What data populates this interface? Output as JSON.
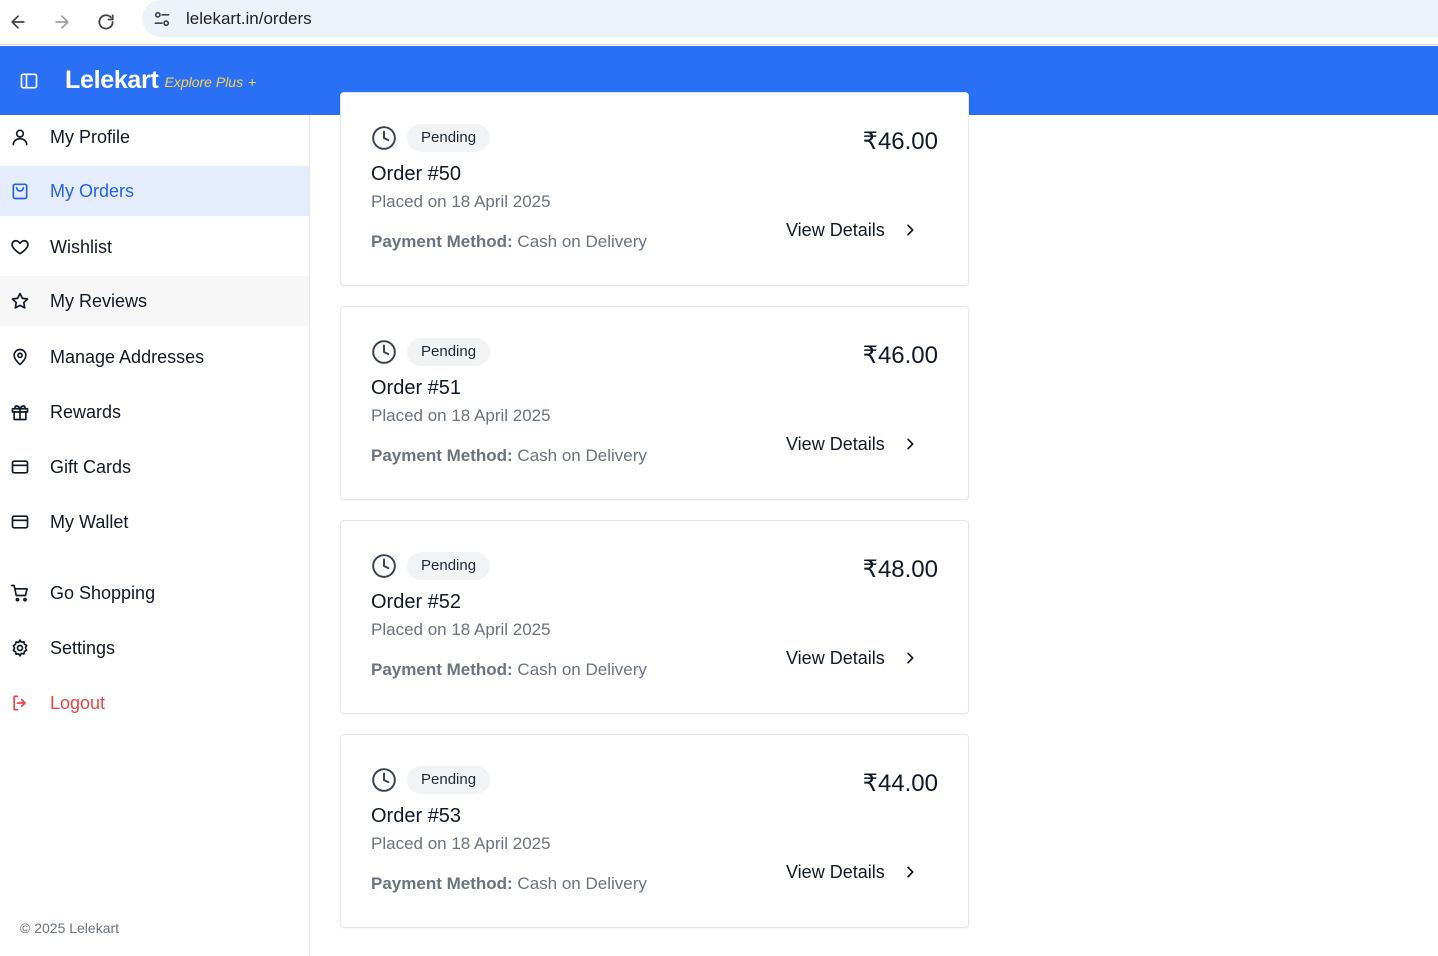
{
  "browser": {
    "url": "lelekart.in/orders"
  },
  "header": {
    "brand": "Lelekart",
    "brand_sub": "Explore Plus",
    "brand_plus": "+",
    "colors": {
      "background": "#2970f4",
      "brand_sub": "#fcd34d"
    }
  },
  "sidebar": {
    "items": [
      {
        "label": "My Profile",
        "icon": "user-icon"
      },
      {
        "label": "My Orders",
        "icon": "shopping-bag-icon",
        "active": true
      },
      {
        "label": "Wishlist",
        "icon": "heart-icon"
      },
      {
        "label": "My Reviews",
        "icon": "star-icon"
      },
      {
        "label": "Manage Addresses",
        "icon": "map-pin-icon"
      },
      {
        "label": "Rewards",
        "icon": "gift-icon"
      },
      {
        "label": "Gift Cards",
        "icon": "credit-card-icon"
      },
      {
        "label": "My Wallet",
        "icon": "wallet-icon"
      },
      {
        "label": "Go Shopping",
        "icon": "shopping-cart-icon"
      },
      {
        "label": "Settings",
        "icon": "settings-icon"
      },
      {
        "label": "Logout",
        "icon": "logout-icon"
      }
    ],
    "copyright": "© 2025 Lelekart",
    "colors": {
      "active_bg": "#e5edfc",
      "active_text": "#2563eb",
      "logout": "#ef4444"
    }
  },
  "orders": [
    {
      "status": "Pending",
      "title": "Order #50",
      "placed": "Placed on 18 April 2025",
      "payment_label": "Payment Method:",
      "payment_value": "Cash on Delivery",
      "price": "₹46.00",
      "action": "View Details"
    },
    {
      "status": "Pending",
      "title": "Order #51",
      "placed": "Placed on 18 April 2025",
      "payment_label": "Payment Method:",
      "payment_value": "Cash on Delivery",
      "price": "₹46.00",
      "action": "View Details"
    },
    {
      "status": "Pending",
      "title": "Order #52",
      "placed": "Placed on 18 April 2025",
      "payment_label": "Payment Method:",
      "payment_value": "Cash on Delivery",
      "price": "₹48.00",
      "action": "View Details"
    },
    {
      "status": "Pending",
      "title": "Order #53",
      "placed": "Placed on 18 April 2025",
      "payment_label": "Payment Method:",
      "payment_value": "Cash on Delivery",
      "price": "₹44.00",
      "action": "View Details"
    }
  ]
}
